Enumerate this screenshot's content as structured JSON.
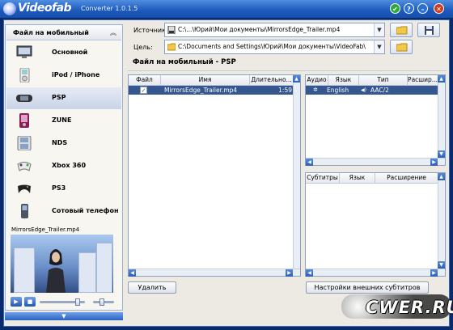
{
  "app": {
    "logo": "Videofab",
    "version": "Converter 1.0.1.5"
  },
  "title_buttons": {
    "ok": "✔",
    "help": "?",
    "min": "–",
    "close": "✕"
  },
  "sidebar": {
    "header": "Файл на мобильный",
    "items": [
      {
        "label": "Основной",
        "icon": "monitor-icon"
      },
      {
        "label": "iPod / iPhone",
        "icon": "ipod-icon"
      },
      {
        "label": "PSP",
        "icon": "psp-icon",
        "selected": true
      },
      {
        "label": "ZUNE",
        "icon": "zune-icon"
      },
      {
        "label": "NDS",
        "icon": "nds-icon"
      },
      {
        "label": "Xbox 360",
        "icon": "xbox-controller-icon"
      },
      {
        "label": "PS3",
        "icon": "ps3-controller-icon"
      },
      {
        "label": "Сотовый телефон",
        "icon": "phone-icon"
      }
    ]
  },
  "preview": {
    "filename": "MirrorsEdge_Trailer.mp4"
  },
  "source": {
    "label": "Источник:",
    "path": "C:\\...\\Юрий\\Мои документы\\MirrorsEdge_Trailer.mp4"
  },
  "target": {
    "label": "Цель:",
    "path": "C:\\Documents and Settings\\Юрий\\Мои документы\\VideoFab\\"
  },
  "section_title": "Файл на мобильный - PSP",
  "files_table": {
    "columns": [
      "Файл",
      "Имя",
      "Длительно..."
    ],
    "rows": [
      {
        "checked": true,
        "name": "MirrorsEdge_Trailer.mp4",
        "duration": "1:59"
      }
    ]
  },
  "audio_table": {
    "columns": [
      "Аудио",
      "Язык",
      "Тип",
      "Расшир..."
    ],
    "rows": [
      {
        "language": "English",
        "type": "AAC/2"
      }
    ]
  },
  "subs_table": {
    "columns": [
      "Субтитры",
      "Язык",
      "Расширение"
    ]
  },
  "buttons": {
    "delete": "Удалить",
    "ext_subs": "Настройки внешних субтитров"
  },
  "watermark": "CWER.RU",
  "colors": {
    "accent": "#1c59bc",
    "selection": "#35568f"
  }
}
